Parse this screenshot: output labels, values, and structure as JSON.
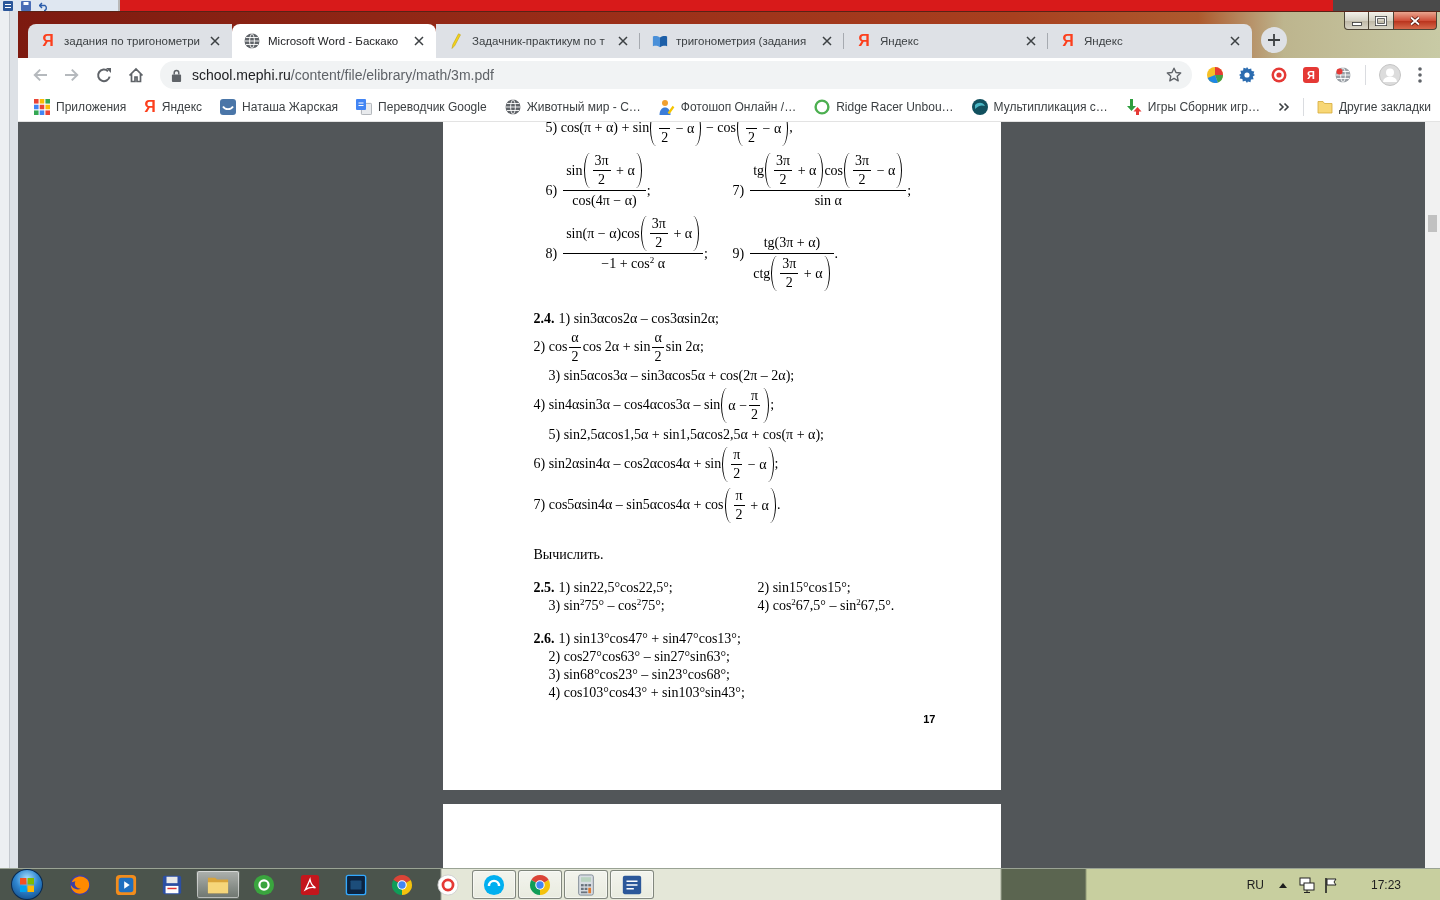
{
  "browser": {
    "tabs": [
      {
        "kind": "letter",
        "glyph": "Я",
        "title": "задания по тригонометри",
        "selected": false
      },
      {
        "kind": "globe",
        "title": "Microsoft Word - Баскако",
        "selected": true
      },
      {
        "kind": "pencil",
        "title": "Задачник-практикум по т",
        "selected": false
      },
      {
        "kind": "book",
        "title": "тригонометрия (задания",
        "selected": false
      },
      {
        "kind": "letter",
        "glyph": "Я",
        "title": "Яндекс",
        "selected": false
      },
      {
        "kind": "letter",
        "glyph": "Я",
        "title": "Яндекс",
        "selected": false
      }
    ],
    "nav": [
      {
        "kind": "back",
        "disabled": true
      },
      {
        "kind": "forward",
        "disabled": true
      },
      {
        "kind": "reload",
        "disabled": false
      },
      {
        "kind": "home",
        "disabled": false
      }
    ],
    "address": {
      "host": "school.mephi.ru",
      "path": "/content/file/elibrary/math/3m.pdf"
    },
    "extensions": [
      {
        "kind": "sphere"
      },
      {
        "kind": "gear"
      },
      {
        "kind": "target"
      },
      {
        "kind": "letter",
        "glyph": "Я"
      },
      {
        "kind": "globe"
      }
    ],
    "bookmarks": [
      {
        "kind": "apps",
        "label": "Приложения"
      },
      {
        "kind": "letter",
        "glyph": "Я",
        "label": "Яндекс"
      },
      {
        "kind": "tile",
        "label": "Наташа Жарская"
      },
      {
        "kind": "pages",
        "label": "Переводчик Google"
      },
      {
        "kind": "globe",
        "label": "Животный мир - С…"
      },
      {
        "kind": "figure",
        "label": "Фотошоп Онлайн /…"
      },
      {
        "kind": "ring",
        "label": "Ridge Racer Unbou…"
      },
      {
        "kind": "ball",
        "label": "Мультипликация с…"
      },
      {
        "kind": "arrows",
        "label": "Игры Сборник игр…"
      }
    ],
    "other_bookmarks": "Другие закладки"
  },
  "pdf": {
    "blocks": [
      {
        "kind": "continuation",
        "lines": [
          [
            {
              "kind": "inline",
              "tokens": [
                {
                  "kind": "text",
                  "text": "5) cos(π + α) + sin"
                },
                {
                  "kind": "paren",
                  "body": [
                    {
                      "kind": "frac",
                      "den": [
                        {
                          "kind": "text",
                          "text": "2"
                        }
                      ]
                    },
                    {
                      "kind": "text",
                      "text": " − α"
                    }
                  ]
                },
                {
                  "kind": "text",
                  "text": " − cos"
                },
                {
                  "kind": "paren",
                  "body": [
                    {
                      "kind": "frac",
                      "den": [
                        {
                          "kind": "text",
                          "text": "2"
                        }
                      ]
                    },
                    {
                      "kind": "text",
                      "text": " − α"
                    }
                  ]
                },
                {
                  "kind": "text",
                  "text": ","
                }
              ]
            }
          ],
          [
            {
              "kind": "display",
              "lead": "6)",
              "num": [
                {
                  "kind": "text",
                  "text": "sin"
                },
                {
                  "kind": "paren",
                  "body": [
                    {
                      "kind": "frac",
                      "num": [
                        {
                          "kind": "text",
                          "text": "3π"
                        }
                      ],
                      "den": [
                        {
                          "kind": "text",
                          "text": "2"
                        }
                      ]
                    },
                    {
                      "kind": "text",
                      "text": " + α"
                    }
                  ]
                }
              ],
              "den": [
                {
                  "kind": "text",
                  "text": "cos(4π − α)"
                }
              ],
              "tail": ";"
            },
            {
              "kind": "display",
              "lead": "7)",
              "num": [
                {
                  "kind": "text",
                  "text": "tg"
                },
                {
                  "kind": "paren",
                  "body": [
                    {
                      "kind": "frac",
                      "num": [
                        {
                          "kind": "text",
                          "text": "3π"
                        }
                      ],
                      "den": [
                        {
                          "kind": "text",
                          "text": "2"
                        }
                      ]
                    },
                    {
                      "kind": "text",
                      "text": " + α"
                    }
                  ]
                },
                {
                  "kind": "text",
                  "text": "cos"
                },
                {
                  "kind": "paren",
                  "body": [
                    {
                      "kind": "frac",
                      "num": [
                        {
                          "kind": "text",
                          "text": "3π"
                        }
                      ],
                      "den": [
                        {
                          "kind": "text",
                          "text": "2"
                        }
                      ]
                    },
                    {
                      "kind": "text",
                      "text": " − α"
                    }
                  ]
                }
              ],
              "den": [
                {
                  "kind": "text",
                  "text": "sin α"
                }
              ],
              "tail": ";"
            }
          ],
          [
            {
              "kind": "display",
              "lead": "8)",
              "num": [
                {
                  "kind": "text",
                  "text": "sin(π − α)cos"
                },
                {
                  "kind": "paren",
                  "body": [
                    {
                      "kind": "frac",
                      "num": [
                        {
                          "kind": "text",
                          "text": "3π"
                        }
                      ],
                      "den": [
                        {
                          "kind": "text",
                          "text": "2"
                        }
                      ]
                    },
                    {
                      "kind": "text",
                      "text": " + α"
                    }
                  ]
                }
              ],
              "den": [
                {
                  "kind": "text",
                  "text": "−1 + cos$^{2}$ α"
                }
              ],
              "tail": ";"
            },
            {
              "kind": "display",
              "lead": "9)",
              "num": [
                {
                  "kind": "text",
                  "text": "tg(3π + α)"
                }
              ],
              "den": [
                {
                  "kind": "text",
                  "text": "ctg"
                },
                {
                  "kind": "paren",
                  "body": [
                    {
                      "kind": "frac",
                      "num": [
                        {
                          "kind": "text",
                          "text": "3π"
                        }
                      ],
                      "den": [
                        {
                          "kind": "text",
                          "text": "2"
                        }
                      ]
                    },
                    {
                      "kind": "text",
                      "text": " + α"
                    }
                  ]
                }
              ],
              "tail": "."
            }
          ]
        ]
      },
      {
        "kind": "problem",
        "label": "2.4.",
        "lines": [
          [
            {
              "kind": "inline",
              "tokens": [
                {
                  "kind": "text",
                  "text": "1) sin3αcos2α – cos3αsin2α;"
                }
              ]
            }
          ],
          [
            {
              "kind": "inline",
              "tokens": [
                {
                  "kind": "text",
                  "text": "2) cos"
                },
                {
                  "kind": "frac",
                  "num": [
                    {
                      "kind": "text",
                      "text": "α"
                    }
                  ],
                  "den": [
                    {
                      "kind": "text",
                      "text": "2"
                    }
                  ]
                },
                {
                  "kind": "text",
                  "text": "cos 2α + sin"
                },
                {
                  "kind": "frac",
                  "num": [
                    {
                      "kind": "text",
                      "text": "α"
                    }
                  ],
                  "den": [
                    {
                      "kind": "text",
                      "text": "2"
                    }
                  ]
                },
                {
                  "kind": "text",
                  "text": "sin 2α;"
                }
              ]
            }
          ],
          [
            {
              "kind": "inline",
              "tokens": [
                {
                  "kind": "text",
                  "text": "3) sin5αcos3α – sin3αcos5α + cos(2π – 2α);"
                }
              ]
            }
          ],
          [
            {
              "kind": "inline",
              "tokens": [
                {
                  "kind": "text",
                  "text": "4) sin4αsin3α – cos4αcos3α – sin"
                },
                {
                  "kind": "paren",
                  "body": [
                    {
                      "kind": "text",
                      "text": "α −"
                    },
                    {
                      "kind": "frac",
                      "num": [
                        {
                          "kind": "text",
                          "text": "π"
                        }
                      ],
                      "den": [
                        {
                          "kind": "text",
                          "text": "2"
                        }
                      ]
                    }
                  ]
                },
                {
                  "kind": "text",
                  "text": ";"
                }
              ]
            }
          ],
          [
            {
              "kind": "inline",
              "tokens": [
                {
                  "kind": "text",
                  "text": "5) sin2,5αcos1,5α + sin1,5αcos2,5α + cos(π + α);"
                }
              ]
            }
          ],
          [
            {
              "kind": "inline",
              "tokens": [
                {
                  "kind": "text",
                  "text": "6) sin2αsin4α – cos2αcos4α + sin"
                },
                {
                  "kind": "paren",
                  "body": [
                    {
                      "kind": "frac",
                      "num": [
                        {
                          "kind": "text",
                          "text": "π"
                        }
                      ],
                      "den": [
                        {
                          "kind": "text",
                          "text": "2"
                        }
                      ]
                    },
                    {
                      "kind": "text",
                      "text": " − α"
                    }
                  ]
                },
                {
                  "kind": "text",
                  "text": ";"
                }
              ]
            }
          ],
          [
            {
              "kind": "inline",
              "tokens": [
                {
                  "kind": "text",
                  "text": "7) cos5αsin4α – sin5αcos4α + cos"
                },
                {
                  "kind": "paren",
                  "body": [
                    {
                      "kind": "frac",
                      "num": [
                        {
                          "kind": "text",
                          "text": "π"
                        }
                      ],
                      "den": [
                        {
                          "kind": "text",
                          "text": "2"
                        }
                      ]
                    },
                    {
                      "kind": "text",
                      "text": " + α"
                    }
                  ]
                },
                {
                  "kind": "text",
                  "text": "."
                }
              ]
            }
          ]
        ]
      },
      {
        "kind": "instruction",
        "text": "Вычислить."
      },
      {
        "kind": "problem",
        "label": "2.5.",
        "lines": [
          [
            {
              "kind": "inline",
              "tokens": [
                {
                  "kind": "text",
                  "text": "1) sin22,5°cos22,5°;"
                }
              ]
            },
            {
              "kind": "inline",
              "tokens": [
                {
                  "kind": "text",
                  "text": "2) sin15°cos15°;"
                }
              ]
            }
          ],
          [
            {
              "kind": "inline",
              "tokens": [
                {
                  "kind": "text",
                  "text": "3) sin$^{2}$75° – cos$^{2}$75°;"
                }
              ]
            },
            {
              "kind": "inline",
              "tokens": [
                {
                  "kind": "text",
                  "text": "4) cos$^{2}$67,5° – sin$^{2}$67,5°."
                }
              ]
            }
          ]
        ]
      },
      {
        "kind": "problem",
        "label": "2.6.",
        "lines": [
          [
            {
              "kind": "inline",
              "tokens": [
                {
                  "kind": "text",
                  "text": "1) sin13°cos47° + sin47°cos13°;"
                }
              ]
            }
          ],
          [
            {
              "kind": "inline",
              "tokens": [
                {
                  "kind": "text",
                  "text": "2) cos27°cos63° – sin27°sin63°;"
                }
              ]
            }
          ],
          [
            {
              "kind": "inline",
              "tokens": [
                {
                  "kind": "text",
                  "text": "3) sin68°cos23° – sin23°cos68°;"
                }
              ]
            }
          ],
          [
            {
              "kind": "inline",
              "tokens": [
                {
                  "kind": "text",
                  "text": "4) cos103°cos43° + sin103°sin43°;"
                }
              ]
            }
          ]
        ]
      }
    ],
    "page_number": "17"
  },
  "taskbar": {
    "apps": [
      {
        "kind": "swirl",
        "running": false
      },
      {
        "kind": "player",
        "running": false
      },
      {
        "kind": "floppy",
        "running": false
      },
      {
        "kind": "folder",
        "running": true
      },
      {
        "kind": "disc",
        "running": false
      },
      {
        "kind": "loop",
        "running": false
      },
      {
        "kind": "square",
        "running": false
      },
      {
        "kind": "segments",
        "running": false
      },
      {
        "kind": "ring",
        "running": false
      },
      {
        "kind": "arc",
        "running": true
      },
      {
        "kind": "segments",
        "running": true
      },
      {
        "kind": "calculator",
        "running": true
      },
      {
        "kind": "document",
        "running": true
      }
    ],
    "tray": {
      "language": "RU",
      "time": "17:23"
    }
  }
}
